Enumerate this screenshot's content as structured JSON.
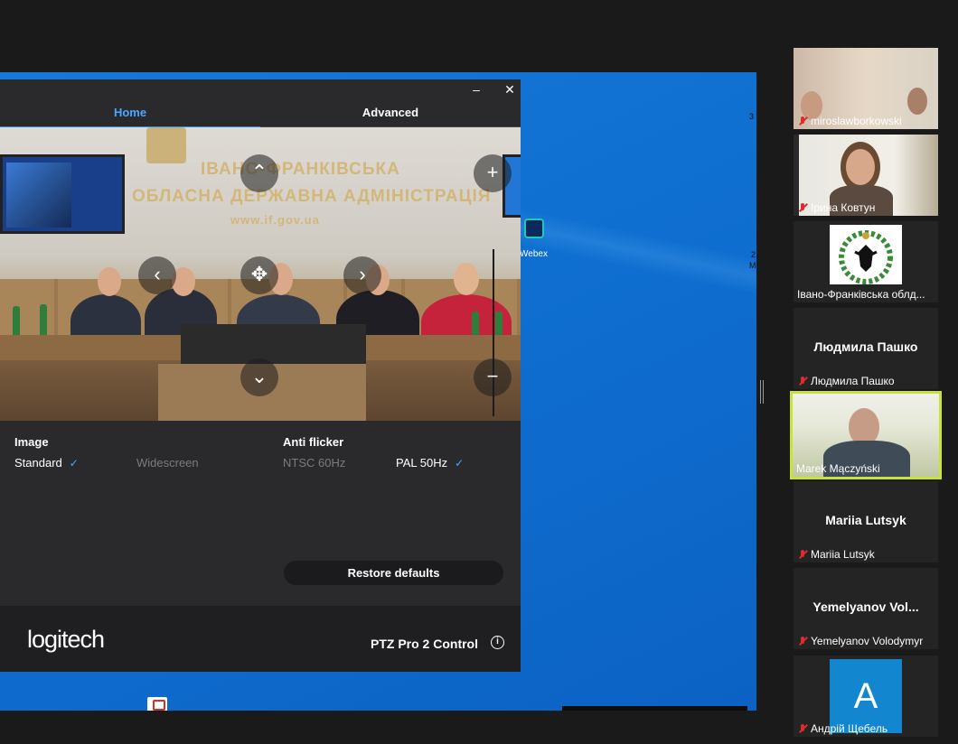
{
  "ptz_window": {
    "minimize": "–",
    "close": "✕",
    "tabs": [
      {
        "label": "Home",
        "active": true
      },
      {
        "label": "Advanced",
        "active": false
      }
    ],
    "camera_feed": {
      "wall_line1": "ІВАНО-ФРАНКІВСЬКА",
      "wall_line2": "ОБЛАСНА ДЕРЖАВНА АДМІНІСТРАЦІЯ",
      "wall_line3": "www.if.gov.ua"
    },
    "controls": {
      "up": "⌃",
      "down": "⌄",
      "left": "‹",
      "right": "›",
      "home": "✥",
      "zoom_in": "+",
      "zoom_out": "−"
    },
    "image": {
      "heading": "Image",
      "options": [
        {
          "label": "Standard",
          "selected": true
        },
        {
          "label": "Widescreen",
          "selected": false
        }
      ]
    },
    "anti_flicker": {
      "heading": "Anti flicker",
      "options": [
        {
          "label": "NTSC 60Hz",
          "selected": false
        },
        {
          "label": "PAL 50Hz",
          "selected": true
        }
      ]
    },
    "check": "✓",
    "restore_label": "Restore defaults",
    "brand": "logitech",
    "product": "PTZ Pro 2 Control",
    "info": "i"
  },
  "desktop": {
    "icon_label": "Webex",
    "edge_text_1": "3",
    "edge_text_2": "2",
    "edge_text_3": "M"
  },
  "participants": [
    {
      "label": "miroslawborkowski",
      "muted": true,
      "type": "video"
    },
    {
      "label": "Ірина Ковтун",
      "muted": true,
      "type": "video"
    },
    {
      "label": "Івано-Франківська облд...",
      "muted": false,
      "type": "crest"
    },
    {
      "label": "Людмила Пашко",
      "display": "Людмила Пашко",
      "muted": true,
      "type": "name"
    },
    {
      "label": "Marek Mączyński",
      "muted": false,
      "type": "video",
      "active": true
    },
    {
      "label": "Mariia Lutsyk",
      "display": "Mariia Lutsyk",
      "muted": true,
      "type": "name"
    },
    {
      "label": "Yemelyanov Volodymyr",
      "display": "Yemelyanov  Vol...",
      "muted": true,
      "type": "name"
    },
    {
      "label": "Андрій Щебель",
      "avatar_letter": "A",
      "muted": true,
      "type": "avatar"
    }
  ],
  "colors": {
    "accent": "#4aa6ff",
    "active_speaker": "#c9e23a",
    "mute": "#e02b2b",
    "desktop_blue": "#0f6fd1"
  }
}
